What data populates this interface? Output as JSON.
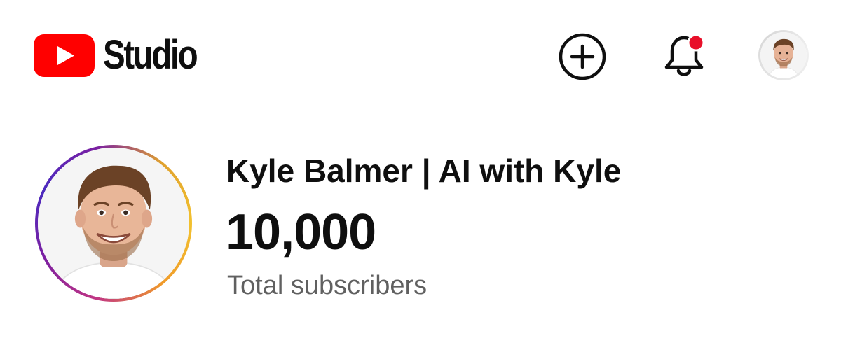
{
  "header": {
    "logo_text": "Studio",
    "logo_icon": "youtube-play-icon",
    "create_icon": "plus-circle-icon",
    "notifications_icon": "bell-icon",
    "notification_dot": true,
    "account_icon": "avatar"
  },
  "channel": {
    "name": "Kyle Balmer | AI with Kyle",
    "subscribers": "10,000",
    "subscribers_label": "Total subscribers"
  },
  "colors": {
    "brand_red": "#ff0000",
    "notification_red": "#e8102a",
    "text_primary": "#0f0f0f",
    "text_secondary": "#606060"
  }
}
